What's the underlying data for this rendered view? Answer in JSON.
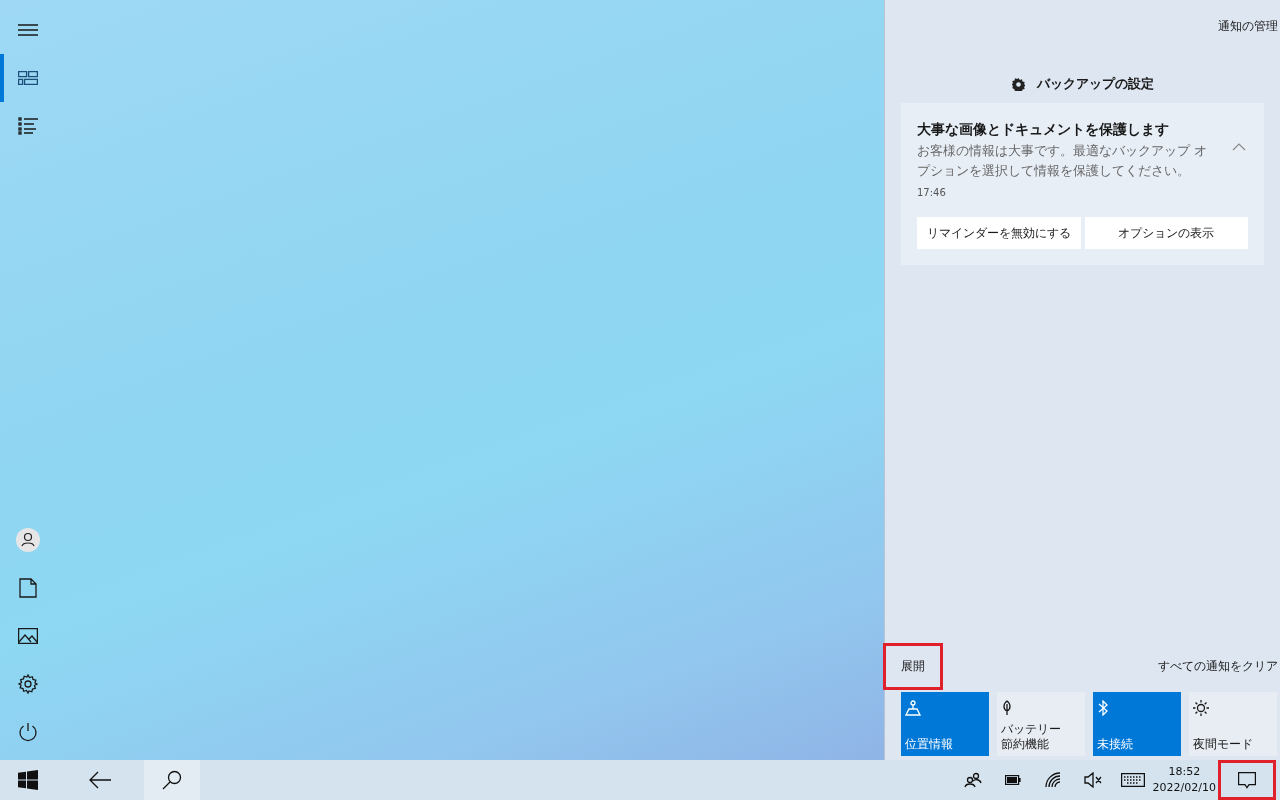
{
  "rail": {
    "top": [
      {
        "kind": "menu",
        "selected": false
      },
      {
        "kind": "tiles",
        "selected": true
      },
      {
        "kind": "list",
        "selected": false
      }
    ],
    "bottom": [
      {
        "kind": "user"
      },
      {
        "kind": "document"
      },
      {
        "kind": "picture"
      },
      {
        "kind": "settings"
      },
      {
        "kind": "power"
      }
    ]
  },
  "action_center": {
    "manage_link": "通知の管理",
    "group_title": "バックアップの設定",
    "notification": {
      "title": "大事な画像とドキュメントを保護します",
      "body": "お客様の情報は大事です。最適なバックアップ オプションを選択して情報を保護してください。",
      "time": "17:46",
      "expanded": true,
      "buttons": [
        "リマインダーを無効にする",
        "オプションの表示"
      ]
    },
    "expand_button": {
      "label": "展開",
      "highlighted": true
    },
    "clear_link": "すべての通知をクリア",
    "quick_actions": [
      {
        "kind": "location",
        "label": [
          "位置情報"
        ],
        "on": true
      },
      {
        "kind": "battery-saver",
        "label": [
          "バッテリー",
          "節約機能"
        ],
        "on": false
      },
      {
        "kind": "bluetooth",
        "label": [
          "未接続"
        ],
        "on": true
      },
      {
        "kind": "night-light",
        "label": [
          "夜間モード"
        ],
        "on": false
      }
    ]
  },
  "taskbar": {
    "left": [
      {
        "kind": "start",
        "selected": false
      },
      {
        "kind": "back",
        "selected": false
      },
      {
        "kind": "search",
        "selected": true
      }
    ],
    "tray": [
      {
        "kind": "people"
      },
      {
        "kind": "battery"
      },
      {
        "kind": "wifi"
      },
      {
        "kind": "volume-muted"
      },
      {
        "kind": "keyboard"
      }
    ],
    "time": "18:52",
    "date": "2022/02/10",
    "action_center_button": {
      "highlighted": true
    }
  }
}
